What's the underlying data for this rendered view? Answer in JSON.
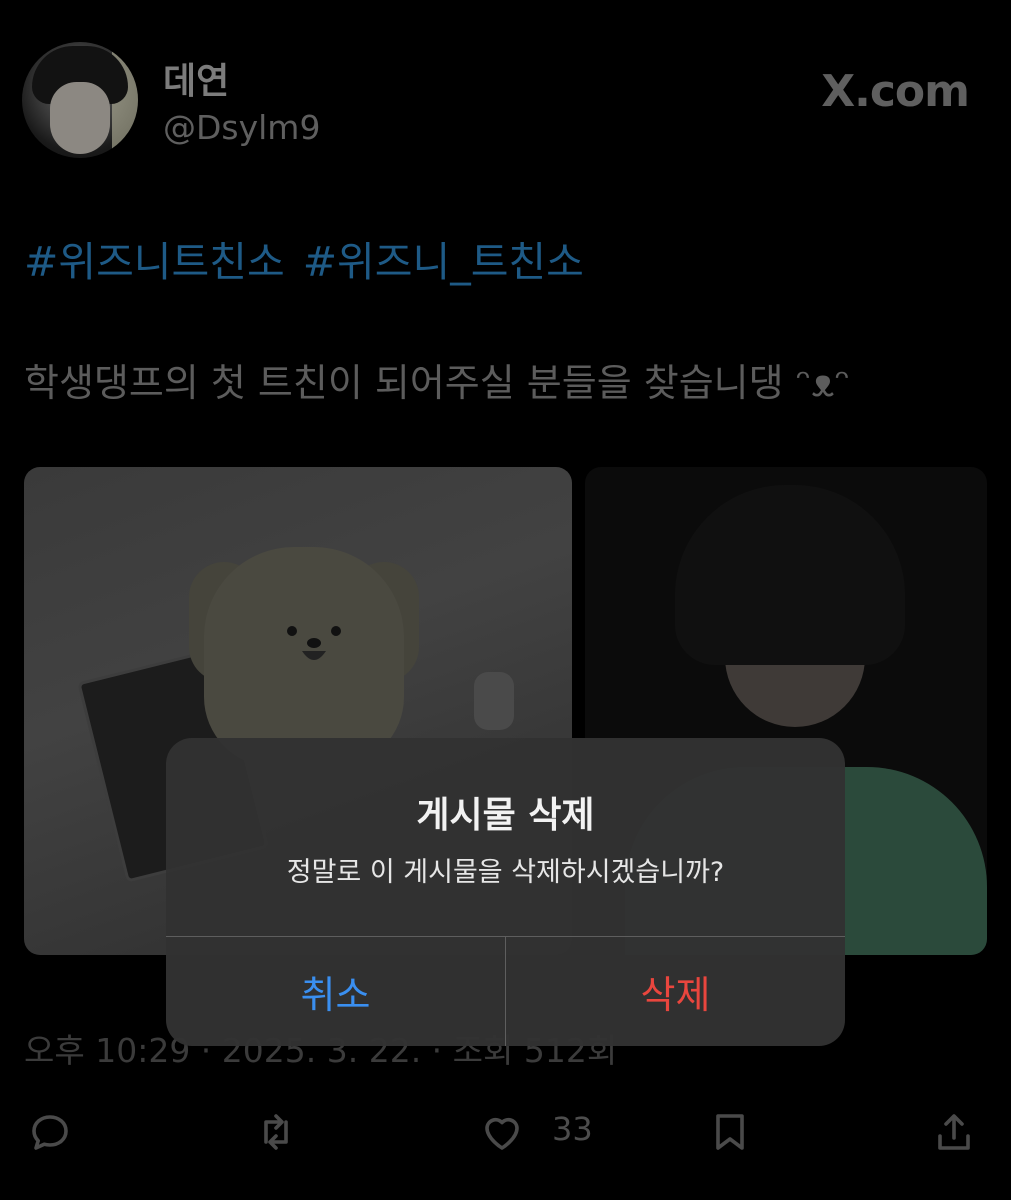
{
  "tweet": {
    "display_name": "데연",
    "handle": "@Dsylm9",
    "source": "X.com",
    "hashtags": [
      "#위즈니트친소",
      "#위즈니_트친소"
    ],
    "text": "학생댕프의 첫 트친이 되어주실 분들을 찾습니댕 ᵔᴥᵔ",
    "timestamp": "오후 10:29 · 2025. 3. 22. · 조회 512회",
    "like_count": "33"
  },
  "dialog": {
    "title": "게시물 삭제",
    "message": "정말로 이 게시물을 삭제하시겠습니까?",
    "cancel_label": "취소",
    "delete_label": "삭제"
  },
  "icons": {
    "reply": "reply-icon",
    "retweet": "retweet-icon",
    "like": "heart-icon",
    "bookmark": "bookmark-icon",
    "share": "share-icon"
  },
  "colors": {
    "hashtag": "#1e5a86",
    "cancel": "#3a8ff0",
    "delete": "#e9463e",
    "dialog_bg": "#323232"
  }
}
